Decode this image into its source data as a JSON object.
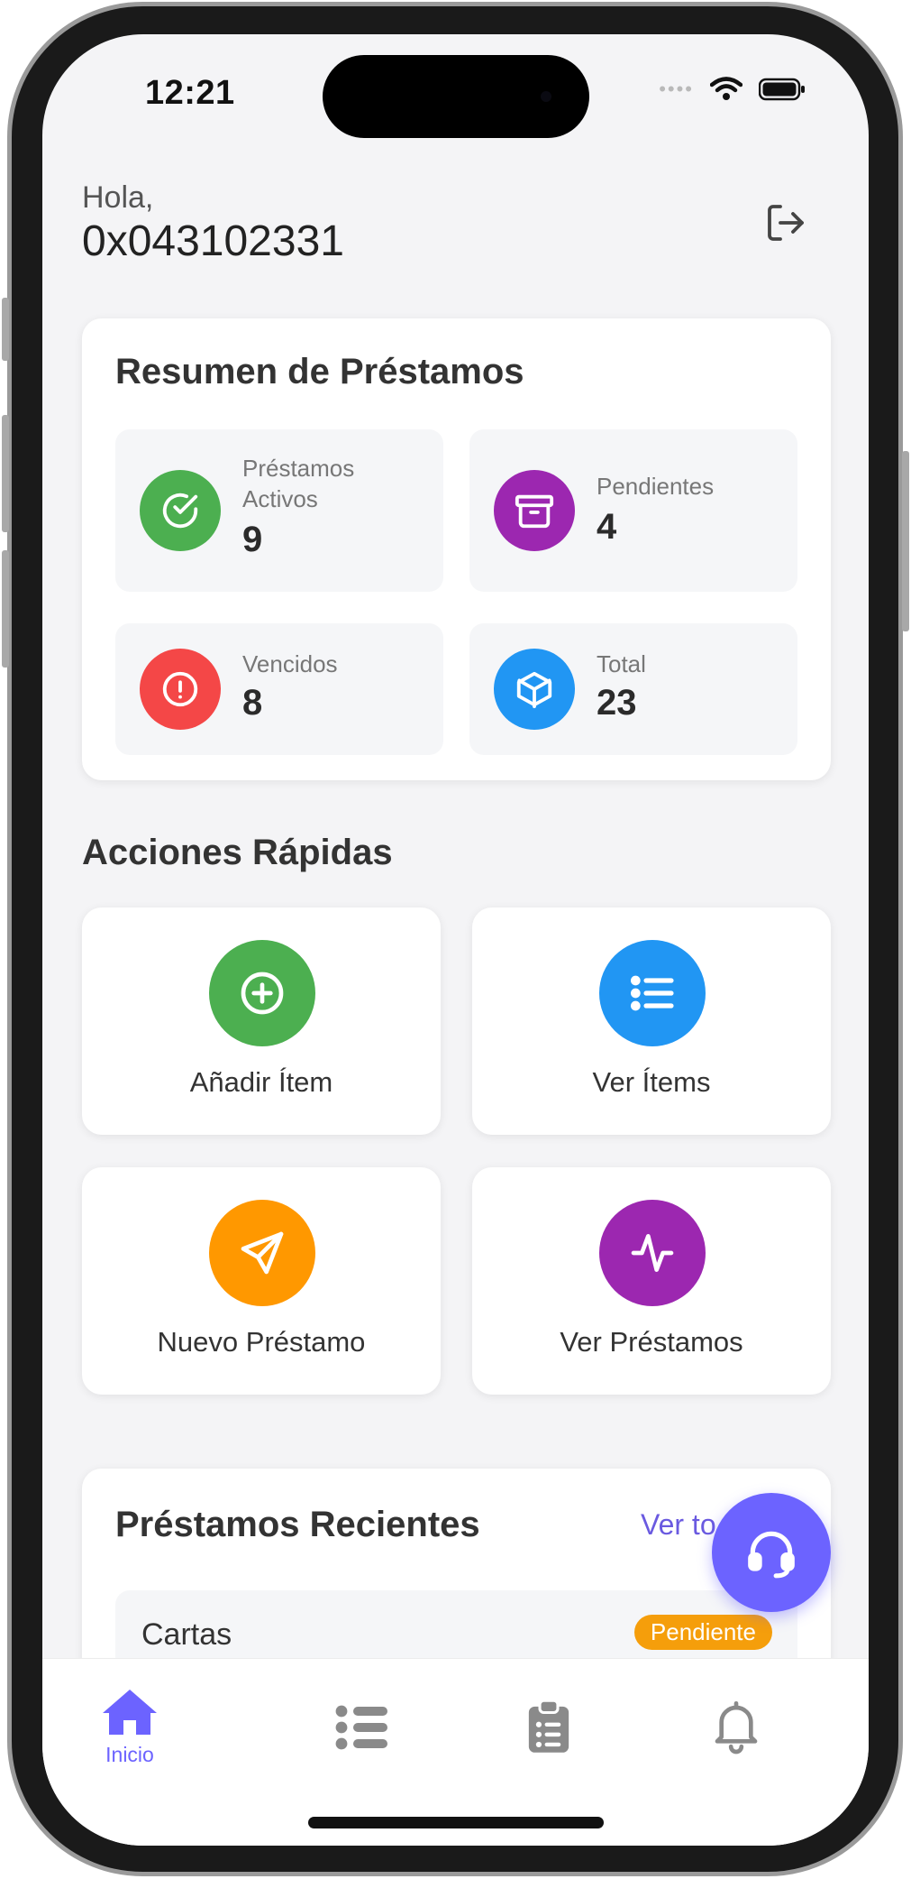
{
  "status_bar": {
    "time": "12:21"
  },
  "header": {
    "greeting": "Hola,",
    "user": "0x043102331",
    "logout_icon": "logout-icon"
  },
  "summary": {
    "title": "Resumen de Préstamos",
    "stats": [
      {
        "label": "Préstamos Activos",
        "value": "9",
        "color": "#4caf50",
        "icon": "check-circle-icon"
      },
      {
        "label": "Pendientes",
        "value": "4",
        "color": "#9c27b0",
        "icon": "archive-icon"
      },
      {
        "label": "Vencidos",
        "value": "8",
        "color": "#f44747",
        "icon": "alert-circle-icon"
      },
      {
        "label": "Total",
        "value": "23",
        "color": "#2196f3",
        "icon": "box-icon"
      }
    ]
  },
  "quick_actions": {
    "title": "Acciones Rápidas",
    "items": [
      {
        "label": "Añadir Ítem",
        "color": "#4caf50",
        "icon": "plus-circle-icon"
      },
      {
        "label": "Ver Ítems",
        "color": "#2196f3",
        "icon": "list-icon"
      },
      {
        "label": "Nuevo Préstamo",
        "color": "#ff9800",
        "icon": "send-icon"
      },
      {
        "label": "Ver Préstamos",
        "color": "#9c27b0",
        "icon": "activity-icon"
      }
    ]
  },
  "recent": {
    "title": "Préstamos Recientes",
    "see_all": "Ver to",
    "items": [
      {
        "name": "Cartas",
        "status": "Pendiente",
        "status_color": "#f59e0b"
      }
    ]
  },
  "fab": {
    "icon": "headset-icon",
    "color": "#6c63ff"
  },
  "tabbar": {
    "items": [
      {
        "label": "Inicio",
        "icon": "home-icon",
        "active": true
      },
      {
        "label": "",
        "icon": "list-icon",
        "active": false
      },
      {
        "label": "",
        "icon": "clipboard-icon",
        "active": false
      },
      {
        "label": "",
        "icon": "bell-icon",
        "active": false
      }
    ],
    "active_color": "#6c63ff",
    "inactive_color": "#8a8a8a"
  }
}
